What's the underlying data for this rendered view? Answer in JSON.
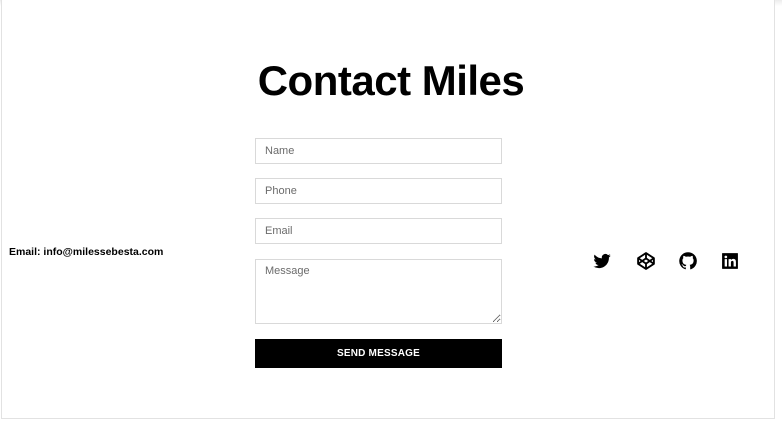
{
  "page": {
    "title": "Contact Miles"
  },
  "form": {
    "name_placeholder": "Name",
    "phone_placeholder": "Phone",
    "email_placeholder": "Email",
    "message_placeholder": "Message",
    "name_value": "",
    "phone_value": "",
    "email_value": "",
    "message_value": "",
    "submit_label": "SEND MESSAGE"
  },
  "contact": {
    "email_text": "Email: info@milessebesta.com"
  },
  "socials": [
    {
      "icon": "twitter-icon"
    },
    {
      "icon": "codepen-icon"
    },
    {
      "icon": "github-icon"
    },
    {
      "icon": "linkedin-icon"
    }
  ],
  "colors": {
    "text": "#000000",
    "button_bg": "#000000",
    "button_text": "#ffffff",
    "border": "#d9d9d9"
  }
}
